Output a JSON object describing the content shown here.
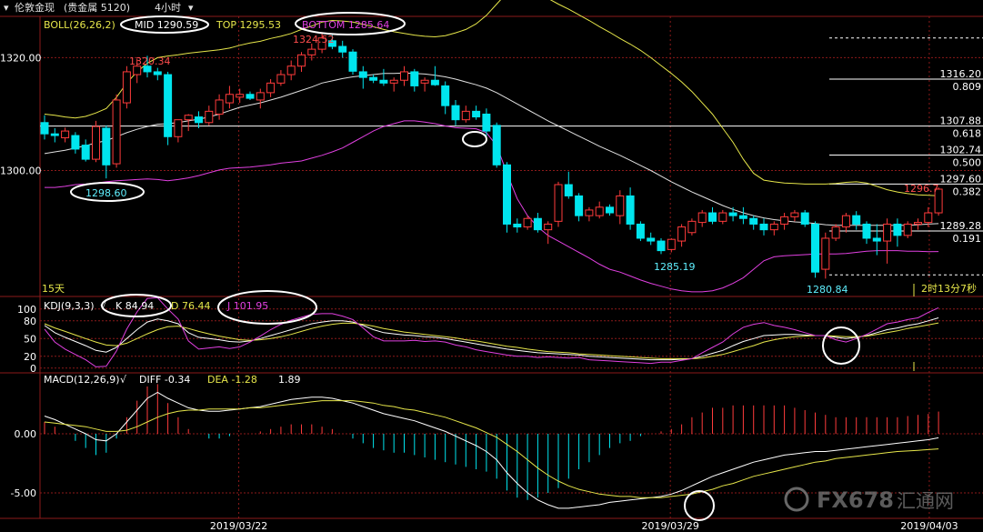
{
  "header": {
    "symbol": "伦敦金现",
    "market": "(贵金属 5120)",
    "timeframe": "4小时",
    "timeframe_suffix": "▾"
  },
  "boll": {
    "label": "BOLL(26,26,2)",
    "mid_label": "MID 1290.59",
    "top_label": "TOP 1295.53",
    "bottom_label": "BOTTOM 1285.64"
  },
  "kdj": {
    "label": "KDJ(9,3,3)",
    "k_label": "K 84.94",
    "d_label": "D 76.44",
    "j_label": "J 101.95"
  },
  "macd": {
    "label": "MACD(12,26,9)",
    "diff_label": "DIFF -0.34",
    "dea_label": "DEA -1.28",
    "macd_value": "1.89"
  },
  "price_axis": {
    "ticks": [
      {
        "value": 1320,
        "label": "1320.00"
      },
      {
        "value": 1300,
        "label": "1300.00"
      }
    ]
  },
  "kdj_axis": {
    "ticks": [
      {
        "value": 100,
        "label": "100"
      },
      {
        "value": 80,
        "label": "80"
      },
      {
        "value": 50,
        "label": "50"
      },
      {
        "value": 20,
        "label": "20"
      },
      {
        "value": 0,
        "label": "0"
      }
    ]
  },
  "macd_axis": {
    "ticks": [
      {
        "value": 0,
        "label": "0.00"
      },
      {
        "value": -5,
        "label": "-5.00"
      }
    ]
  },
  "fib_levels": [
    {
      "price": 1316.2,
      "ratio": "0.809",
      "price_label": "1316.20"
    },
    {
      "price": 1307.88,
      "ratio": "0.618",
      "price_label": "1307.88"
    },
    {
      "price": 1302.74,
      "ratio": "0.500",
      "price_label": "1302.74"
    },
    {
      "price": 1297.6,
      "ratio": "0.382",
      "price_label": "1297.60"
    },
    {
      "price": 1289.28,
      "ratio": "0.191",
      "price_label": "1289.28"
    }
  ],
  "annotations": {
    "high1": "1320.34",
    "high2": "1324.52",
    "low1": "1298.60",
    "low2": "1285.19",
    "low3": "1280.84",
    "last": "1296.7",
    "period": "15天",
    "countdown": "2时13分7秒"
  },
  "dates": [
    {
      "index": 9,
      "label": "2019/03/22"
    },
    {
      "index": 29,
      "label": "2019/03/29"
    },
    {
      "index": 41,
      "label": "2019/04/03"
    }
  ],
  "watermark": "FX678",
  "watermark_cn": "汇通网",
  "colors": {
    "up": "#ff3b3b",
    "down": "#00e5ee",
    "mid": "#e0e0e0",
    "top": "#e6e64a",
    "bottom": "#e040e0"
  },
  "chart_data": {
    "type": "candlestick",
    "candles": [
      {
        "o": 1308.5,
        "h": 1309.8,
        "l": 1305.5,
        "c": 1306.5
      },
      {
        "o": 1306.5,
        "h": 1307.5,
        "l": 1305.0,
        "c": 1306.2
      },
      {
        "o": 1305.8,
        "h": 1307.6,
        "l": 1305.0,
        "c": 1307.0
      },
      {
        "o": 1306.2,
        "h": 1306.8,
        "l": 1303.0,
        "c": 1303.8
      },
      {
        "o": 1304.5,
        "h": 1305.5,
        "l": 1301.6,
        "c": 1302.0
      },
      {
        "o": 1302.0,
        "h": 1308.8,
        "l": 1301.5,
        "c": 1307.8
      },
      {
        "o": 1307.5,
        "h": 1308.0,
        "l": 1298.6,
        "c": 1301.0
      },
      {
        "o": 1301.2,
        "h": 1313.5,
        "l": 1300.5,
        "c": 1312.5
      },
      {
        "o": 1312.0,
        "h": 1318.5,
        "l": 1311.0,
        "c": 1317.5
      },
      {
        "o": 1317.0,
        "h": 1319.8,
        "l": 1315.5,
        "c": 1318.5
      },
      {
        "o": 1318.5,
        "h": 1320.34,
        "l": 1316.5,
        "c": 1317.5
      },
      {
        "o": 1317.5,
        "h": 1318.2,
        "l": 1316.0,
        "c": 1317.0
      },
      {
        "o": 1317.0,
        "h": 1317.5,
        "l": 1304.5,
        "c": 1306.0
      },
      {
        "o": 1306.0,
        "h": 1309.0,
        "l": 1305.0,
        "c": 1309.0
      },
      {
        "o": 1309.0,
        "h": 1310.0,
        "l": 1307.0,
        "c": 1309.8
      },
      {
        "o": 1309.5,
        "h": 1310.5,
        "l": 1307.5,
        "c": 1308.5
      },
      {
        "o": 1308.5,
        "h": 1311.5,
        "l": 1308.0,
        "c": 1310.5
      },
      {
        "o": 1310.0,
        "h": 1313.5,
        "l": 1309.0,
        "c": 1312.5
      },
      {
        "o": 1312.0,
        "h": 1315.0,
        "l": 1311.0,
        "c": 1313.5
      },
      {
        "o": 1313.0,
        "h": 1314.5,
        "l": 1312.0,
        "c": 1313.5
      },
      {
        "o": 1313.5,
        "h": 1314.0,
        "l": 1312.5,
        "c": 1312.8
      },
      {
        "o": 1312.5,
        "h": 1314.5,
        "l": 1311.0,
        "c": 1313.8
      },
      {
        "o": 1313.8,
        "h": 1316.2,
        "l": 1313.0,
        "c": 1315.5
      },
      {
        "o": 1315.5,
        "h": 1317.8,
        "l": 1315.0,
        "c": 1317.0
      },
      {
        "o": 1317.0,
        "h": 1319.5,
        "l": 1316.0,
        "c": 1318.5
      },
      {
        "o": 1318.5,
        "h": 1321.0,
        "l": 1317.5,
        "c": 1320.5
      },
      {
        "o": 1320.5,
        "h": 1322.5,
        "l": 1319.5,
        "c": 1321.5
      },
      {
        "o": 1321.5,
        "h": 1324.52,
        "l": 1320.8,
        "c": 1323.5
      },
      {
        "o": 1323.0,
        "h": 1324.0,
        "l": 1321.5,
        "c": 1322.0
      },
      {
        "o": 1322.0,
        "h": 1323.0,
        "l": 1320.0,
        "c": 1321.0
      },
      {
        "o": 1321.0,
        "h": 1321.5,
        "l": 1317.0,
        "c": 1317.6
      },
      {
        "o": 1317.5,
        "h": 1318.5,
        "l": 1314.5,
        "c": 1316.5
      },
      {
        "o": 1316.5,
        "h": 1317.0,
        "l": 1315.5,
        "c": 1316.0
      },
      {
        "o": 1316.0,
        "h": 1318.0,
        "l": 1315.0,
        "c": 1315.5
      },
      {
        "o": 1315.5,
        "h": 1316.5,
        "l": 1314.0,
        "c": 1316.0
      },
      {
        "o": 1316.0,
        "h": 1318.5,
        "l": 1315.0,
        "c": 1317.5
      },
      {
        "o": 1317.5,
        "h": 1318.0,
        "l": 1314.0,
        "c": 1315.0
      },
      {
        "o": 1315.5,
        "h": 1316.5,
        "l": 1314.0,
        "c": 1316.0
      },
      {
        "o": 1316.0,
        "h": 1318.5,
        "l": 1315.0,
        "c": 1315.2
      },
      {
        "o": 1315.0,
        "h": 1315.8,
        "l": 1310.0,
        "c": 1311.5
      },
      {
        "o": 1311.5,
        "h": 1312.5,
        "l": 1308.0,
        "c": 1309.0
      },
      {
        "o": 1309.0,
        "h": 1311.5,
        "l": 1308.5,
        "c": 1310.5
      },
      {
        "o": 1310.5,
        "h": 1311.5,
        "l": 1309.0,
        "c": 1309.5
      },
      {
        "o": 1310.0,
        "h": 1311.0,
        "l": 1306.0,
        "c": 1307.0
      },
      {
        "o": 1308.0,
        "h": 1308.5,
        "l": 1300.5,
        "c": 1301.0
      },
      {
        "o": 1301.0,
        "h": 1301.5,
        "l": 1289.0,
        "c": 1290.5
      },
      {
        "o": 1290.5,
        "h": 1291.5,
        "l": 1289.0,
        "c": 1290.0
      },
      {
        "o": 1290.0,
        "h": 1292.0,
        "l": 1289.5,
        "c": 1291.5
      },
      {
        "o": 1291.5,
        "h": 1292.5,
        "l": 1289.0,
        "c": 1289.5
      },
      {
        "o": 1289.5,
        "h": 1291.0,
        "l": 1287.0,
        "c": 1290.5
      },
      {
        "o": 1291.0,
        "h": 1298.0,
        "l": 1290.0,
        "c": 1297.5
      },
      {
        "o": 1297.5,
        "h": 1299.8,
        "l": 1295.0,
        "c": 1295.5
      },
      {
        "o": 1295.5,
        "h": 1296.0,
        "l": 1291.0,
        "c": 1292.0
      },
      {
        "o": 1292.0,
        "h": 1293.5,
        "l": 1291.0,
        "c": 1293.0
      },
      {
        "o": 1292.0,
        "h": 1294.5,
        "l": 1291.5,
        "c": 1293.5
      },
      {
        "o": 1293.5,
        "h": 1294.0,
        "l": 1292.0,
        "c": 1292.5
      },
      {
        "o": 1292.0,
        "h": 1296.5,
        "l": 1290.5,
        "c": 1295.5
      },
      {
        "o": 1295.5,
        "h": 1297.0,
        "l": 1289.5,
        "c": 1290.5
      },
      {
        "o": 1290.5,
        "h": 1291.0,
        "l": 1287.5,
        "c": 1288.0
      },
      {
        "o": 1288.0,
        "h": 1289.0,
        "l": 1286.8,
        "c": 1287.5
      },
      {
        "o": 1287.5,
        "h": 1288.0,
        "l": 1285.19,
        "c": 1285.8
      },
      {
        "o": 1286.0,
        "h": 1288.0,
        "l": 1285.5,
        "c": 1287.8
      },
      {
        "o": 1287.5,
        "h": 1290.5,
        "l": 1286.5,
        "c": 1290.0
      },
      {
        "o": 1289.0,
        "h": 1291.5,
        "l": 1288.5,
        "c": 1291.0
      },
      {
        "o": 1290.8,
        "h": 1293.0,
        "l": 1290.0,
        "c": 1292.5
      },
      {
        "o": 1292.5,
        "h": 1293.5,
        "l": 1290.5,
        "c": 1291.0
      },
      {
        "o": 1291.0,
        "h": 1293.0,
        "l": 1290.5,
        "c": 1292.5
      },
      {
        "o": 1292.5,
        "h": 1293.5,
        "l": 1291.0,
        "c": 1292.0
      },
      {
        "o": 1292.0,
        "h": 1293.5,
        "l": 1290.5,
        "c": 1291.5
      },
      {
        "o": 1291.5,
        "h": 1292.0,
        "l": 1289.5,
        "c": 1290.5
      },
      {
        "o": 1290.5,
        "h": 1291.5,
        "l": 1288.5,
        "c": 1289.5
      },
      {
        "o": 1289.5,
        "h": 1291.0,
        "l": 1288.5,
        "c": 1290.5
      },
      {
        "o": 1290.5,
        "h": 1292.5,
        "l": 1289.5,
        "c": 1291.8
      },
      {
        "o": 1291.8,
        "h": 1293.0,
        "l": 1291.0,
        "c": 1292.5
      },
      {
        "o": 1292.5,
        "h": 1293.0,
        "l": 1290.0,
        "c": 1290.5
      },
      {
        "o": 1290.5,
        "h": 1291.0,
        "l": 1281.0,
        "c": 1282.0
      },
      {
        "o": 1282.5,
        "h": 1289.0,
        "l": 1280.84,
        "c": 1288.0
      },
      {
        "o": 1288.0,
        "h": 1290.5,
        "l": 1287.5,
        "c": 1290.0
      },
      {
        "o": 1290.0,
        "h": 1292.5,
        "l": 1289.0,
        "c": 1292.0
      },
      {
        "o": 1292.0,
        "h": 1292.8,
        "l": 1289.5,
        "c": 1290.5
      },
      {
        "o": 1290.5,
        "h": 1291.0,
        "l": 1287.0,
        "c": 1288.0
      },
      {
        "o": 1288.0,
        "h": 1290.5,
        "l": 1285.0,
        "c": 1287.5
      },
      {
        "o": 1287.5,
        "h": 1291.5,
        "l": 1283.5,
        "c": 1290.5
      },
      {
        "o": 1290.5,
        "h": 1291.5,
        "l": 1286.5,
        "c": 1288.5
      },
      {
        "o": 1288.5,
        "h": 1291.0,
        "l": 1288.0,
        "c": 1290.5
      },
      {
        "o": 1290.5,
        "h": 1291.5,
        "l": 1289.5,
        "c": 1290.8
      },
      {
        "o": 1290.8,
        "h": 1293.5,
        "l": 1290.0,
        "c": 1292.5
      },
      {
        "o": 1292.5,
        "h": 1297.0,
        "l": 1292.0,
        "c": 1296.7
      }
    ],
    "price_range": [
      1278,
      1327
    ],
    "kdj_range": [
      -5,
      115
    ],
    "macd_range": [
      -7,
      5
    ],
    "mid": [
      1303,
      1303.3,
      1303.6,
      1304,
      1304.4,
      1304.9,
      1305.3,
      1306,
      1306.7,
      1307.3,
      1307.8,
      1308.2,
      1308.3,
      1308.5,
      1308.8,
      1309.1,
      1309.5,
      1310,
      1310.6,
      1311.2,
      1311.6,
      1312,
      1312.5,
      1313,
      1313.6,
      1314.2,
      1314.8,
      1315.5,
      1315.9,
      1316.3,
      1316.6,
      1316.8,
      1317,
      1317.2,
      1317.2,
      1317.3,
      1317.2,
      1317.1,
      1316.9,
      1316.6,
      1316.2,
      1315.7,
      1315.2,
      1314.6,
      1313.8,
      1312.8,
      1311.8,
      1310.8,
      1309.8,
      1308.8,
      1307.9,
      1307,
      1306.1,
      1305.2,
      1304.3,
      1303.5,
      1302.7,
      1301.8,
      1300.9,
      1300,
      1299,
      1298,
      1297.1,
      1296.2,
      1295.4,
      1294.6,
      1293.8,
      1293.1,
      1292.5,
      1292,
      1291.6,
      1291.3,
      1291.1,
      1290.9,
      1290.8,
      1290.6,
      1290.4,
      1290.3,
      1290.3,
      1290.3,
      1290.3,
      1290.3,
      1290.3,
      1290.3,
      1290.3,
      1290.4,
      1290.5,
      1290.59
    ],
    "top": [
      1310,
      1309.8,
      1309.5,
      1309.3,
      1309.6,
      1310.2,
      1311,
      1313,
      1315.5,
      1317.5,
      1319,
      1320,
      1320.3,
      1320.5,
      1320.8,
      1321,
      1321.2,
      1321.4,
      1321.7,
      1322.2,
      1322.6,
      1322.9,
      1323.4,
      1323.8,
      1324.3,
      1325,
      1325.6,
      1326.3,
      1326.6,
      1326.5,
      1326.3,
      1325.9,
      1325.5,
      1325,
      1324.6,
      1324.3,
      1324,
      1323.8,
      1323.7,
      1323.9,
      1324.4,
      1325,
      1326,
      1327.5,
      1329.5,
      1331.5,
      1332,
      1332,
      1331.5,
      1330.5,
      1329.5,
      1328.6,
      1327.6,
      1326.6,
      1325.5,
      1324.5,
      1323.4,
      1322.4,
      1321.3,
      1320,
      1318.6,
      1317.2,
      1315.7,
      1314,
      1312,
      1310,
      1307.5,
      1305,
      1302,
      1299.5,
      1298.3,
      1298,
      1297.8,
      1297.7,
      1297.6,
      1297.6,
      1297.6,
      1297.7,
      1297.9,
      1298,
      1297.8,
      1297.2,
      1296.6,
      1296.2,
      1295.9,
      1295.7,
      1295.6,
      1295.53
    ],
    "bottom": [
      1297,
      1297,
      1297.2,
      1297.5,
      1297.6,
      1297.8,
      1298,
      1298.2,
      1298.3,
      1298.4,
      1298.5,
      1298.4,
      1298.2,
      1298.4,
      1298.7,
      1299.1,
      1299.6,
      1300.1,
      1300.4,
      1300.5,
      1300.6,
      1300.8,
      1301,
      1301.3,
      1301.5,
      1301.7,
      1302.2,
      1302.7,
      1303.3,
      1304,
      1305,
      1306,
      1307,
      1307.8,
      1308.3,
      1308.8,
      1308.8,
      1308.6,
      1308.3,
      1307.9,
      1307.6,
      1307.5,
      1307.4,
      1306.7,
      1304.4,
      1299.5,
      1295,
      1292,
      1290,
      1288.5,
      1287.5,
      1286.5,
      1285.5,
      1284.5,
      1283.4,
      1282.5,
      1282,
      1281.3,
      1280.6,
      1280,
      1279.5,
      1279,
      1278.7,
      1278.5,
      1278.5,
      1278.7,
      1279.2,
      1280,
      1281,
      1282.5,
      1284,
      1284.7,
      1284.9,
      1285,
      1285.1,
      1285.2,
      1285.2,
      1285.2,
      1285.3,
      1285.5,
      1285.7,
      1285.8,
      1285.8,
      1285.8,
      1285.7,
      1285.7,
      1285.6,
      1285.64
    ],
    "kdj_k": [
      72,
      60,
      52,
      45,
      38,
      30,
      27,
      35,
      50,
      65,
      78,
      83,
      80,
      75,
      60,
      52,
      50,
      48,
      45,
      44,
      46,
      50,
      55,
      60,
      65,
      70,
      75,
      78,
      80,
      80,
      78,
      72,
      65,
      60,
      58,
      56,
      55,
      53,
      52,
      50,
      47,
      44,
      41,
      38,
      35,
      32,
      30,
      28,
      26,
      25,
      24,
      23,
      22,
      20,
      19,
      18,
      17,
      16,
      15,
      14,
      14,
      14,
      15,
      16,
      20,
      25,
      30,
      38,
      45,
      50,
      55,
      56,
      57,
      57,
      56,
      55,
      55,
      52,
      50,
      52,
      55,
      60,
      65,
      68,
      72,
      75,
      80,
      85
    ],
    "kdj_d": [
      75,
      68,
      62,
      56,
      50,
      44,
      39,
      38,
      42,
      50,
      58,
      65,
      70,
      71,
      67,
      62,
      58,
      54,
      51,
      48,
      47,
      48,
      50,
      53,
      57,
      62,
      67,
      71,
      74,
      76,
      76,
      74,
      71,
      67,
      64,
      61,
      59,
      57,
      55,
      53,
      51,
      48,
      46,
      43,
      40,
      37,
      35,
      32,
      30,
      28,
      27,
      26,
      24,
      23,
      22,
      21,
      20,
      19,
      18,
      17,
      16,
      16,
      16,
      16,
      17,
      20,
      23,
      28,
      33,
      38,
      44,
      48,
      51,
      53,
      54,
      55,
      55,
      54,
      53,
      53,
      54,
      57,
      60,
      63,
      67,
      70,
      73,
      76.4
    ],
    "kdj_j": [
      66,
      44,
      32,
      23,
      14,
      2,
      3,
      29,
      66,
      95,
      118,
      119,
      100,
      83,
      46,
      32,
      34,
      36,
      33,
      36,
      44,
      54,
      65,
      74,
      81,
      86,
      91,
      92,
      92,
      88,
      82,
      68,
      53,
      46,
      46,
      46,
      47,
      45,
      46,
      44,
      39,
      36,
      31,
      28,
      25,
      22,
      20,
      20,
      18,
      19,
      18,
      17,
      18,
      14,
      13,
      12,
      11,
      10,
      9,
      8,
      10,
      10,
      13,
      16,
      26,
      35,
      44,
      58,
      69,
      74,
      77,
      72,
      69,
      65,
      60,
      55,
      55,
      48,
      44,
      50,
      57,
      66,
      75,
      78,
      82,
      85,
      94,
      102
    ],
    "macd_diff": [
      1.5,
      1.2,
      0.8,
      0.4,
      0,
      -0.5,
      -0.6,
      0,
      1,
      2,
      3,
      3.5,
      3,
      2.6,
      2.2,
      2,
      1.9,
      1.9,
      2,
      2.1,
      2.2,
      2.3,
      2.5,
      2.7,
      2.9,
      3,
      3.1,
      3.1,
      3,
      2.8,
      2.6,
      2.3,
      2,
      1.7,
      1.5,
      1.3,
      1.1,
      0.8,
      0.5,
      0.2,
      -0.2,
      -0.6,
      -1,
      -1.5,
      -2.2,
      -3.3,
      -4.2,
      -5,
      -5.6,
      -6,
      -6.3,
      -6.3,
      -6.2,
      -6.1,
      -6,
      -5.8,
      -5.7,
      -5.6,
      -5.5,
      -5.4,
      -5.3,
      -5.1,
      -4.8,
      -4.4,
      -4,
      -3.6,
      -3.3,
      -3,
      -2.7,
      -2.4,
      -2.2,
      -2,
      -1.8,
      -1.7,
      -1.6,
      -1.5,
      -1.5,
      -1.4,
      -1.3,
      -1.2,
      -1.1,
      -1,
      -0.9,
      -0.8,
      -0.7,
      -0.6,
      -0.5,
      -0.34
    ],
    "macd_dea": [
      1,
      0.9,
      0.8,
      0.7,
      0.6,
      0.4,
      0.2,
      0.2,
      0.3,
      0.6,
      1,
      1.4,
      1.7,
      1.9,
      2,
      2,
      2.1,
      2.1,
      2.1,
      2.1,
      2.2,
      2.2,
      2.3,
      2.4,
      2.5,
      2.6,
      2.7,
      2.8,
      2.8,
      2.8,
      2.8,
      2.7,
      2.6,
      2.4,
      2.3,
      2.1,
      2,
      1.8,
      1.6,
      1.4,
      1.1,
      0.8,
      0.5,
      0.1,
      -0.3,
      -0.9,
      -1.5,
      -2.2,
      -2.9,
      -3.5,
      -4,
      -4.4,
      -4.7,
      -4.9,
      -5.1,
      -5.2,
      -5.3,
      -5.3,
      -5.4,
      -5.4,
      -5.4,
      -5.3,
      -5.2,
      -5.1,
      -4.9,
      -4.7,
      -4.4,
      -4.2,
      -3.9,
      -3.6,
      -3.4,
      -3.2,
      -3,
      -2.8,
      -2.6,
      -2.4,
      -2.3,
      -2.1,
      -2,
      -1.9,
      -1.8,
      -1.7,
      -1.6,
      -1.5,
      -1.45,
      -1.4,
      -1.34,
      -1.28
    ]
  }
}
